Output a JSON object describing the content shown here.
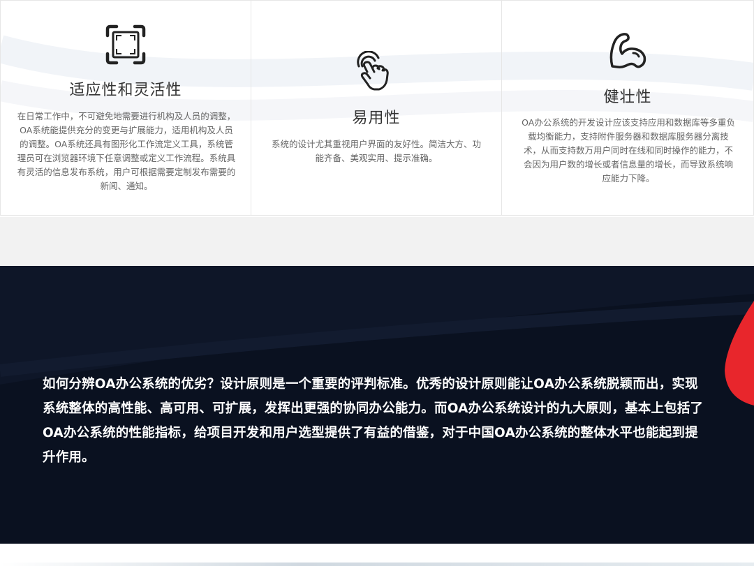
{
  "features": [
    {
      "icon": "fullscreen-frame-icon",
      "title": "适应性和灵活性",
      "description": "在日常工作中，不可避免地需要进行机构及人员的调整，OA系统能提供充分的变更与扩展能力，适用机构及人员的调整。OA系统还具有图形化工作流定义工具，系统管理员可在浏览器环境下任意调整或定义工作流程。系统具有灵活的信息发布系统，用户可根据需要定制发布需要的新闻、通知。"
    },
    {
      "icon": "touch-hand-icon",
      "title": "易用性",
      "description": "系统的设计尤其重视用户界面的友好性。简洁大方、功能齐备、美观实用、提示准确。"
    },
    {
      "icon": "flexed-arm-icon",
      "title": "健壮性",
      "description": "OA办公系统的开发设计应该支持应用和数据库等多重负载均衡能力，支持附件服务器和数据库服务器分离技术，从而支持数万用户同时在线和同时操作的能力，不会因为用户数的增长或者信息量的增长，而导致系统响应能力下降。"
    }
  ],
  "intro": {
    "text": "如何分辨OA办公系统的优劣？设计原则是一个重要的评判标准。优秀的设计原则能让OA办公系统脱颖而出，实现系统整体的高性能、高可用、可扩展，发挥出更强的协同办公能力。而OA办公系统设计的九大原则，基本上包括了OA办公系统的性能指标，给项目开发和用户选型提供了有益的借鉴，对于中国OA办公系统的整体水平也能起到提升作用。"
  },
  "colors": {
    "dark_bg": "#0a1120",
    "accent_red": "#e8262c",
    "title_text": "#333333",
    "body_text": "#666666"
  }
}
